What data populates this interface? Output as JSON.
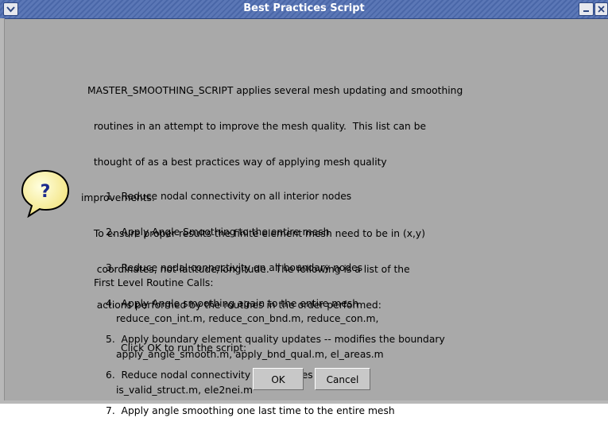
{
  "window": {
    "title": "Best Practices Script",
    "menu_icon": "chevron-down-icon",
    "minimize_icon": "minimize-icon",
    "close_icon": "close-icon"
  },
  "dialog": {
    "icon": "question-bubble-icon",
    "intro_lines": [
      "MASTER_SMOOTHING_SCRIPT applies several mesh updating and smoothing",
      "  routines in an attempt to improve the mesh quality.  This list can be",
      "  thought of as a best practices way of applying mesh quality",
      "improvements.",
      "  To ensure proper results the finite element mesh need to be in (x,y)",
      "   coordinates, not latitude/longitude.  The following is a list of the",
      "   actions performed by the routines in the order performed:"
    ],
    "steps": [
      "1.  Reduce nodal connectivity on all interior nodes",
      "2.  Apply Angle Smoothing to the entire mesh",
      "3.  Reduce nodal connectivity on all boundary nodes",
      "4.  Apply Angle smoothing again to the entire mesh",
      "5.  Apply boundary element quality updates -- modifies the boundary",
      "6.  Reduce nodal connectivity on all nodes",
      "7.  Apply angle smoothing one last time to the entire mesh"
    ],
    "routine_header": "First Level Routine Calls:",
    "routine_lines": [
      "reduce_con_int.m, reduce_con_bnd.m, reduce_con.m,",
      "apply_angle_smooth.m, apply_bnd_qual.m, el_areas.m",
      "is_valid_struct.m, ele2nei.m"
    ],
    "prompt": "Click OK to run the script:",
    "ok_label": "OK",
    "cancel_label": "Cancel"
  }
}
